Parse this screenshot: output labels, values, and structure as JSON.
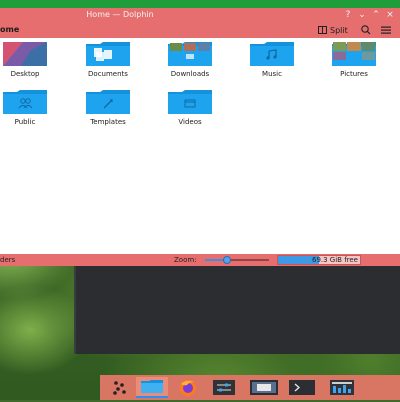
{
  "window": {
    "title": "Home — Dolphin",
    "controls": [
      "?",
      "⌄",
      "⌃",
      "×"
    ]
  },
  "toolbar": {
    "location": "ome",
    "split_label": "Split"
  },
  "places": [
    {
      "label": "Desktop",
      "icon": "desktop-folder-icon"
    },
    {
      "label": "Documents",
      "icon": "documents-folder-icon"
    },
    {
      "label": "Downloads",
      "icon": "downloads-folder-icon"
    },
    {
      "label": "Music",
      "icon": "music-folder-icon"
    },
    {
      "label": "Pictures",
      "icon": "pictures-folder-icon"
    },
    {
      "label": "Public",
      "icon": "public-folder-icon"
    },
    {
      "label": "Templates",
      "icon": "templates-folder-icon"
    },
    {
      "label": "Videos",
      "icon": "videos-folder-icon"
    }
  ],
  "statusbar": {
    "left_text": "ders",
    "zoom_label": "Zoom:",
    "zoom_fraction": 0.35,
    "free_space": "69.3 GiB free",
    "used_fraction": 0.5
  },
  "taskbar": {
    "items": [
      {
        "icon": "app-launcher-icon"
      },
      {
        "icon": "dolphin-icon",
        "active": true
      },
      {
        "icon": "firefox-icon"
      },
      {
        "icon": "system-settings-icon"
      },
      {
        "icon": "screenshot-icon"
      },
      {
        "icon": "terminal-icon"
      },
      {
        "icon": "task-manager-icon"
      }
    ]
  },
  "colors": {
    "accent": "#e66e6e",
    "folder": "#1e9de6",
    "selection": "#2f8ff0"
  }
}
